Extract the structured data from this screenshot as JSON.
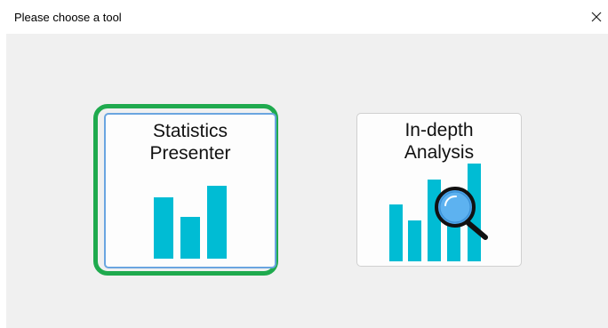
{
  "window": {
    "title": "Please choose a tool",
    "close_glyph": "✕"
  },
  "tools": [
    {
      "label_line1": "Statistics",
      "label_line2": "Presenter",
      "icon": "bar-chart-icon",
      "selected": true
    },
    {
      "label_line1": "In-depth",
      "label_line2": "Analysis",
      "icon": "bar-chart-magnifier-icon",
      "selected": false
    }
  ],
  "colors": {
    "bar": "#00bcd4",
    "selection_outline": "#1faa4e",
    "focus_border": "#6aa5e0",
    "magnifier_lens": "#4aa3e8",
    "background": "#f0f0f0"
  }
}
